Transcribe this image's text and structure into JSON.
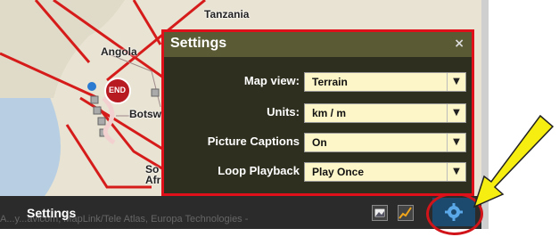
{
  "map": {
    "labels": {
      "tanzania": "Tanzania",
      "angola": "Angola",
      "botswana": "Botsw",
      "south_africa_1": "So",
      "south_africa_2": "Afr",
      "end_marker": "END"
    }
  },
  "dialog": {
    "title": "Settings",
    "close": "×",
    "rows": [
      {
        "label": "Map view:",
        "value": "Terrain"
      },
      {
        "label": "Units:",
        "value": "km / m"
      },
      {
        "label": "Picture Captions",
        "value": "On"
      },
      {
        "label": "Loop Playback",
        "value": "Play Once"
      }
    ]
  },
  "bottom_bar": {
    "title": "Settings",
    "copyright": "A...y...avicom, MapLink/Tele Atlas, Europa Technologies -"
  },
  "colors": {
    "accent_red": "#e0101a",
    "arrow_yellow": "#f6ee10",
    "route_red": "#d61b1b"
  }
}
